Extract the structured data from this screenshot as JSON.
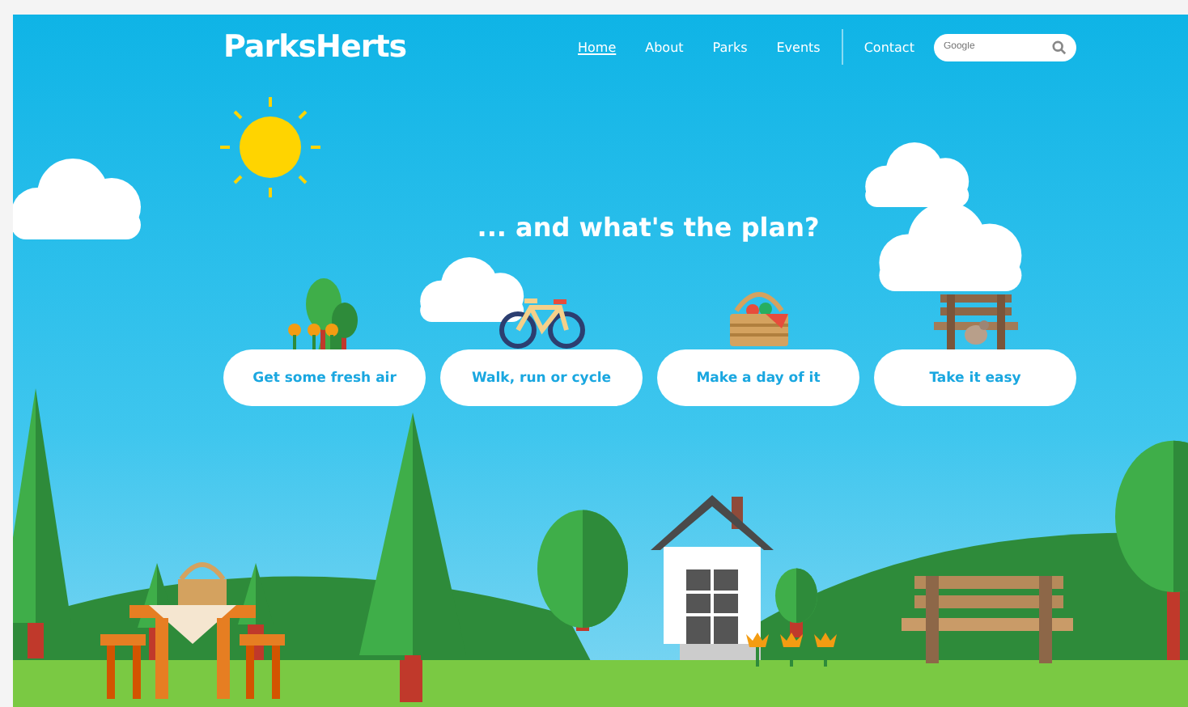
{
  "header": {
    "logo": "ParksHerts",
    "nav": [
      {
        "label": "Home",
        "selected": true
      },
      {
        "label": "About",
        "selected": false
      },
      {
        "label": "Parks",
        "selected": false
      },
      {
        "label": "Events",
        "selected": false
      },
      {
        "label": "Contact",
        "selected": false
      }
    ],
    "search": {
      "placeholder": "Google"
    }
  },
  "headline": "... and what's the plan?",
  "activities": [
    {
      "label": "Get some fresh air",
      "kind": "trees"
    },
    {
      "label": "Walk, run or cycle",
      "kind": "bicycle"
    },
    {
      "label": "Make a day of it",
      "kind": "basket"
    },
    {
      "label": "Take it easy",
      "kind": "bench"
    }
  ]
}
